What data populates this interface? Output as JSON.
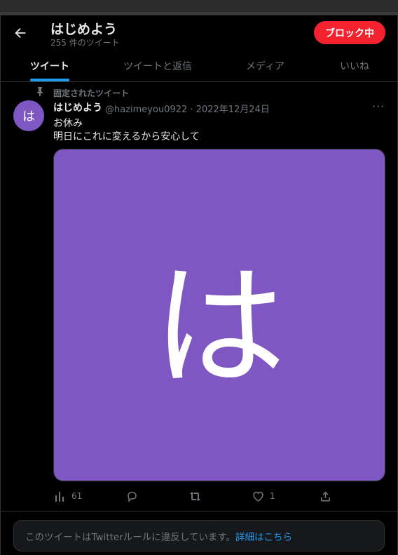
{
  "header": {
    "title": "はじめよう",
    "subtitle": "255 件のツイート",
    "block_button": "ブロック中"
  },
  "tabs": [
    "ツイート",
    "ツイートと返信",
    "メディア",
    "いいね"
  ],
  "pinned": {
    "label": "固定されたツイート"
  },
  "tweet": {
    "avatar_char": "は",
    "name": "はじめよう",
    "handle": "@hazimeyou0922 · 2022年12月24日",
    "lines": [
      "お休み",
      "明日にこれに変えるから安心して"
    ],
    "media_char": "は",
    "stats": {
      "views": "61",
      "likes": "1"
    }
  },
  "notice": {
    "text": "このツイートはTwitterルールに違反しています。",
    "link": "詳細はこちら"
  },
  "colors": {
    "accent": "#1d9bf0",
    "block": "#f4212e",
    "avatar": "#7e57c2"
  }
}
